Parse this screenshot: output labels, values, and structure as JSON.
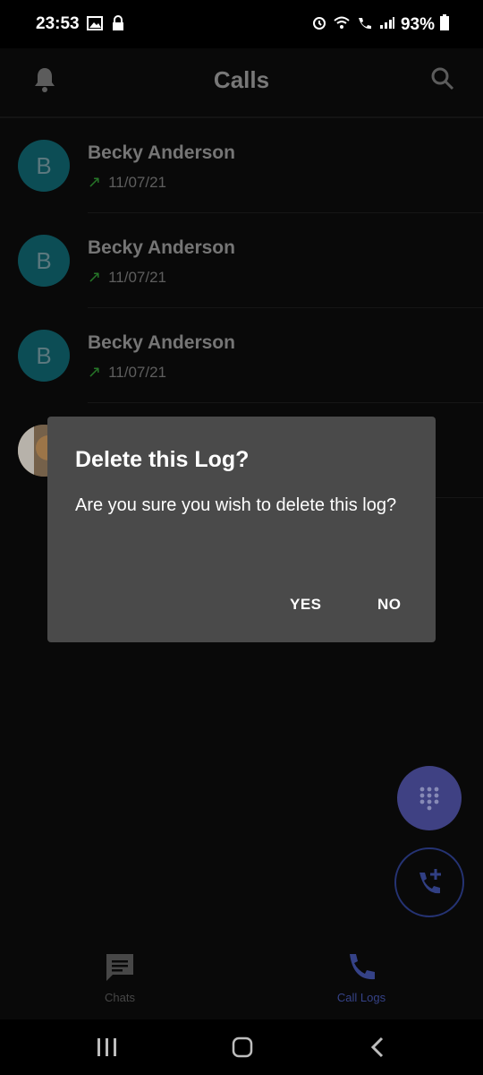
{
  "status_bar": {
    "time": "23:53",
    "battery": "93%"
  },
  "header": {
    "title": "Calls"
  },
  "calls": [
    {
      "initial": "B",
      "name": "Becky Anderson",
      "date": "11/07/21",
      "direction": "outgoing"
    },
    {
      "initial": "B",
      "name": "Becky Anderson",
      "date": "11/07/21",
      "direction": "outgoing"
    },
    {
      "initial": "B",
      "name": "Becky Anderson",
      "date": "11/07/21",
      "direction": "outgoing"
    }
  ],
  "dialog": {
    "title": "Delete this Log?",
    "message": "Are you sure you wish to delete this log?",
    "yes_label": "YES",
    "no_label": "NO"
  },
  "bottom_nav": {
    "chats_label": "Chats",
    "call_logs_label": "Call Logs",
    "active": "Call Logs"
  },
  "colors": {
    "accent": "#3f4e9f",
    "avatar_bg": "#0f5b64",
    "dialog_bg": "#4a4a4a",
    "outgoing_arrow": "#2d8a2f"
  },
  "icons": {
    "status_left": [
      "image-icon",
      "lock-icon"
    ],
    "status_right": [
      "alarm-icon",
      "wifi-icon",
      "wifi-calling-icon",
      "signal-icon",
      "battery-icon"
    ],
    "header_left": "bell-icon",
    "header_right": "search-icon",
    "fab_primary": "dialpad-icon",
    "fab_secondary": "add-call-icon",
    "nav_chats": "chat-icon",
    "nav_calls": "phone-icon",
    "system_nav": [
      "recents-icon",
      "home-icon",
      "back-icon"
    ]
  }
}
